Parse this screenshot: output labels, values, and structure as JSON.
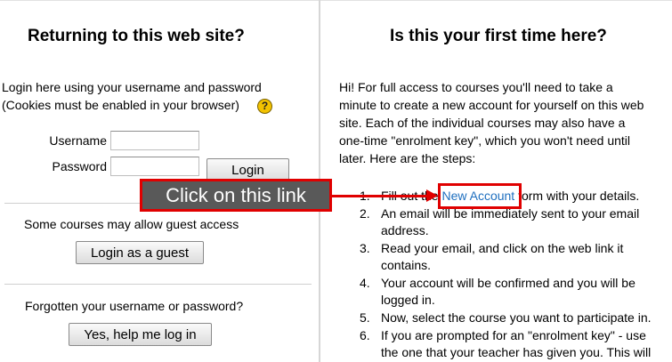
{
  "left": {
    "title": "Returning to this web site?",
    "intro_line1": "Login here using your username and password",
    "intro_line2": "(Cookies must be enabled in your browser)",
    "help_icon_glyph": "?",
    "username_label": "Username",
    "password_label": "Password",
    "username_value": "",
    "password_value": "",
    "login_button": "Login",
    "guest_text": "Some courses may allow guest access",
    "guest_button": "Login as a guest",
    "forgot_text": "Forgotten your username or password?",
    "forgot_button": "Yes, help me log in"
  },
  "right": {
    "title": "Is this your first time here?",
    "para": [
      "Hi! For full access to courses you'll need to take a",
      "minute to create a new account for yourself on this web",
      "site. Each of the individual courses may also have a",
      "one-time \"enrolment key\", which you won't need until",
      "later. Here are the steps:"
    ],
    "steps": [
      {
        "num": "1.",
        "lines": [
          "Fill out the ",
          "New Account",
          " form with your details."
        ]
      },
      {
        "num": "2.",
        "lines": [
          "An email will be immediately sent to your email",
          "address."
        ]
      },
      {
        "num": "3.",
        "lines": [
          "Read your email, and click on the web link it",
          "contains."
        ]
      },
      {
        "num": "4.",
        "lines": [
          "Your account will be confirmed and you will be",
          "logged in."
        ]
      },
      {
        "num": "5.",
        "lines": [
          "Now, select the course you want to participate in."
        ]
      },
      {
        "num": "6.",
        "lines": [
          "If you are prompted for an \"enrolment key\" - use",
          "the one that your teacher has given you. This will"
        ]
      }
    ]
  },
  "annotation": {
    "callout_text": "Click on this link",
    "highlight_color": "#e00000"
  }
}
